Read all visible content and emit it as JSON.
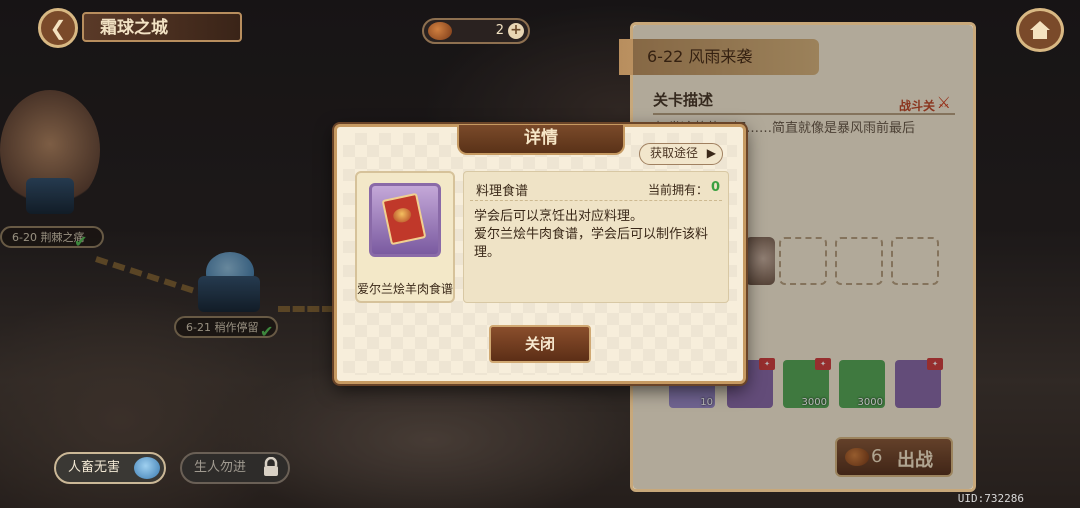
{
  "header": {
    "area_title": "霜球之城",
    "currency_amount": "2"
  },
  "map": {
    "nodes": [
      {
        "label": "6-20 荆棘之痛"
      },
      {
        "label": "6-21 稍作停留"
      }
    ]
  },
  "toggles": {
    "on_label": "人畜无害",
    "off_label": "生人勿进"
  },
  "uid": "UID:732286",
  "stage_panel": {
    "title": "6-22 风雨来袭",
    "section_title": "关卡描述",
    "stage_type": "战斗关",
    "description": "打发冷静的一切……简直就像是暴风雨前最后",
    "rewards": [
      {
        "count": "10"
      },
      {
        "count": ""
      },
      {
        "count": "3000"
      },
      {
        "count": "3000"
      },
      {
        "count": ""
      }
    ],
    "fight_cost": "6",
    "fight_label": "出战"
  },
  "modal": {
    "title": "详情",
    "source_button": "获取途径",
    "item_name": "爱尔兰烩羊肉食谱",
    "item_type": "料理食谱",
    "owned_label": "当前拥有：",
    "owned_count": "0",
    "desc_line1": "学会后可以烹饪出对应料理。",
    "desc_line2": "爱尔兰烩牛肉食谱，学会后可以制作该料理。",
    "close_button": "关闭"
  },
  "colors": {
    "modal_bg": "#f7eedb",
    "modal_border": "#c69a62",
    "button_brown": "#7a4a2a",
    "owned_green": "#3aa040",
    "item_frame_purple": "#8a6aa8"
  }
}
